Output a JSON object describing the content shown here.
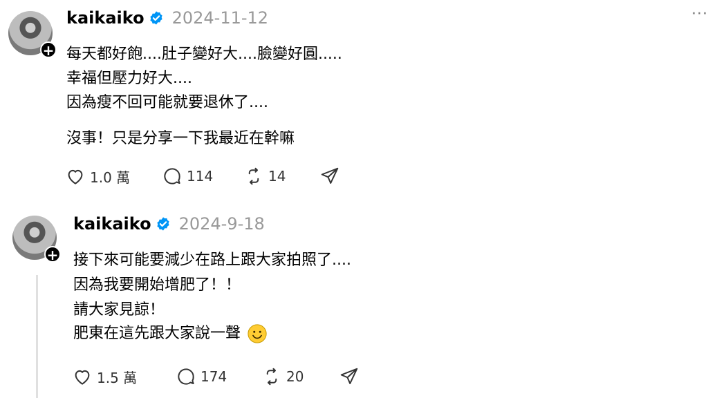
{
  "posts": [
    {
      "username": "kaikaiko",
      "date": "2024-11-12",
      "more": "···",
      "lines": [
        "每天都好飽....肚子變好大....臉變好圓.....",
        "幸福但壓力好大....",
        "因為瘦不回可能就要退休了....",
        "沒事！只是分享一下我最近在幹嘛"
      ],
      "likes": "1.0 萬",
      "comments": "114",
      "reposts": "14"
    },
    {
      "username": "kaikaiko",
      "date": "2024-9-18",
      "lines": [
        "接下來可能要減少在路上跟大家拍照了....",
        "因為我要開始增肥了！！",
        "請大家見諒！",
        "肥東在這先跟大家說一聲"
      ],
      "likes": "1.5 萬",
      "comments": "174",
      "reposts": "20"
    }
  ],
  "icons": {
    "verified": "verified-badge-icon",
    "like": "heart-icon",
    "comment": "comment-bubble-icon",
    "repost": "repost-icon",
    "share": "send-icon",
    "emoji": "smiley-emoji"
  },
  "colors": {
    "verified": "#0095f6",
    "date": "#999999"
  }
}
